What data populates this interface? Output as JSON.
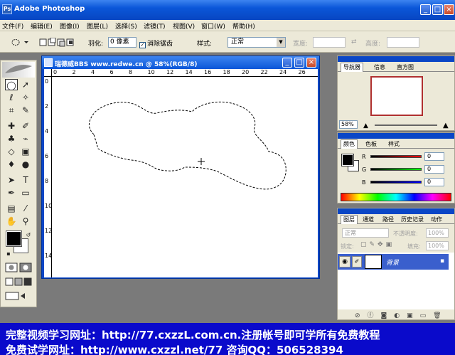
{
  "app": {
    "title": "Adobe Photoshop",
    "icon_label": "Ps"
  },
  "window_controls": {
    "minimize": "_",
    "maximize": "□",
    "close": "×"
  },
  "menu": [
    "文件(F)",
    "编辑(E)",
    "图像(I)",
    "图层(L)",
    "选择(S)",
    "滤镜(T)",
    "视图(V)",
    "窗口(W)",
    "帮助(H)"
  ],
  "options": {
    "feather_label": "羽化:",
    "feather_value": "0 像素",
    "antialias_label": "消除锯齿",
    "antialias_checked": true,
    "style_label": "样式:",
    "style_value": "正常",
    "width_label": "宽度:",
    "height_label": "高度:"
  },
  "tools": [
    "marquee-tool",
    "move-tool",
    "lasso-tool",
    "magic-wand-tool",
    "crop-tool",
    "slice-tool",
    "healing-brush-tool",
    "brush-tool",
    "clone-stamp-tool",
    "history-brush-tool",
    "eraser-tool",
    "gradient-tool",
    "blur-tool",
    "dodge-tool",
    "path-selection-tool",
    "type-tool",
    "pen-tool",
    "shape-tool",
    "notes-tool",
    "eyedropper-tool",
    "hand-tool",
    "zoom-tool"
  ],
  "document": {
    "title": "瑞德威BBS www.redwe.cn @ 58%(RGB/8)",
    "ruler_h": [
      "0",
      "2",
      "4",
      "6",
      "8",
      "10",
      "12",
      "14",
      "16",
      "18",
      "20",
      "22",
      "24",
      "26"
    ],
    "ruler_v": [
      "0",
      "2",
      "4",
      "6",
      "8",
      "10",
      "12",
      "14"
    ]
  },
  "navigator": {
    "tabs": [
      "导航器",
      "信息",
      "直方图"
    ],
    "zoom": "58%"
  },
  "color": {
    "tabs": [
      "颜色",
      "色板",
      "样式"
    ],
    "channels": [
      {
        "label": "R",
        "value": "0"
      },
      {
        "label": "G",
        "value": "0"
      },
      {
        "label": "B",
        "value": "0"
      }
    ]
  },
  "layers": {
    "tabs": [
      "图层",
      "通道",
      "路径",
      "历史记录",
      "动作"
    ],
    "blend_mode": "正常",
    "opacity_label": "不透明度:",
    "opacity_value": "100%",
    "lock_label": "锁定:",
    "fill_label": "填充:",
    "fill_value": "100%",
    "items": [
      {
        "name": "背景"
      }
    ]
  },
  "caption": {
    "line1": "完整视频学习网址：http://77.cxzzL.com.cn.注册帐号即可学所有免费教程",
    "line2": "免费试学网址：http://www.cxzzl.net/77  咨询QQ：506528394"
  }
}
